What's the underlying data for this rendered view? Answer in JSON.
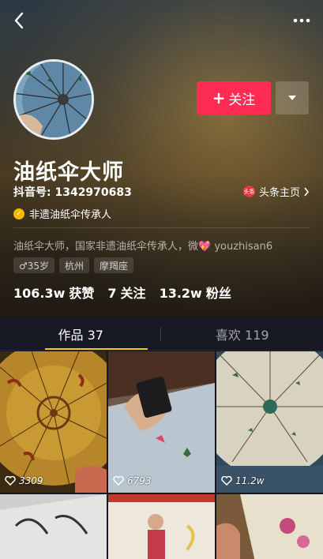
{
  "profile": {
    "name": "油纸伞大师",
    "douyin_id": "抖音号: 1342970683",
    "toutiao_link": "头条主页",
    "toutiao_badge": "头条",
    "verification": "非遗油纸伞传承人",
    "bio_prefix": "油纸伞大师，国家非遗油纸伞传承人，微",
    "bio_suffix": " youzhisan6",
    "tags": [
      "♂35岁",
      "杭州",
      "摩羯座"
    ]
  },
  "actions": {
    "follow_label": "关注",
    "follow_plus": "+"
  },
  "stats": {
    "likes_num": "106.3w",
    "likes_label": "获赞",
    "following_num": "7",
    "following_label": "关注",
    "fans_num": "13.2w",
    "fans_label": "粉丝"
  },
  "tabs": [
    {
      "label": "作品 37",
      "active": true
    },
    {
      "label": "喜欢 119",
      "active": false
    }
  ],
  "videos": [
    {
      "likes": "3309"
    },
    {
      "likes": "6793"
    },
    {
      "likes": "11.2w"
    },
    {
      "likes": ""
    },
    {
      "likes": ""
    },
    {
      "likes": ""
    }
  ],
  "colors": {
    "follow_button": "#fe2c55",
    "tab_indicator": "#f5c518",
    "background": "#161823",
    "verify_badge": "#f5b800"
  },
  "icons": {
    "back": "chevron-left-icon",
    "more": "more-dots-icon",
    "dropdown": "triangle-down-icon",
    "verify": "verified-badge-icon",
    "like": "heart-outline-icon",
    "toutiao_arrow": "chevron-right-icon"
  }
}
